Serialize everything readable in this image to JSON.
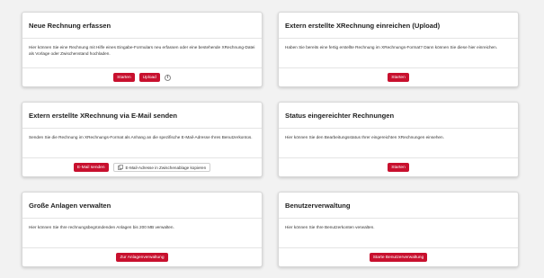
{
  "cards": [
    {
      "title": "Neue Rechnung erfassen",
      "description": "Hier können Sie eine Rechnung mit Hilfe eines Eingabe-Formulars neu erfassen oder eine bestehende XRechnung-Datei als Vorlage oder Zwischenstand hochladen.",
      "buttons": [
        "Starten",
        "Upload"
      ],
      "info_icon": "info-icon"
    },
    {
      "title": "Extern erstellte XRechnung einreichen (Upload)",
      "description": "Haben Sie bereits eine fertig erstellte Rechnung im XRechnungs-Format? Dann können Sie diese hier einreichen.",
      "buttons": [
        "Starten"
      ]
    },
    {
      "title": "Extern erstellte XRechnung via E-Mail senden",
      "description": "Senden Sie die Rechnung im XRechnungs-Format als Anhang an die spezifische E-Mail-Adresse Ihres Benutzerkontos.",
      "buttons": [
        "E-Mail senden"
      ],
      "copy_button": "E-Mail-Adresse in Zwischenablage kopieren",
      "copy_icon": "copy-icon"
    },
    {
      "title": "Status eingereichter Rechnungen",
      "description": "Hier können Sie den Bearbeitungsstatus Ihrer eingereichten XRechnungen einsehen.",
      "buttons": [
        "Starten"
      ]
    },
    {
      "title": "Große Anlagen verwalten",
      "description": "Hier können Sie Ihre rechnungsbegründenden Anlagen bis 200 MB verwalten.",
      "buttons": [
        "Zur Anlagenverwaltung"
      ]
    },
    {
      "title": "Benutzerverwaltung",
      "description": "Hier können Sie Ihre Benutzerkonten verwalten.",
      "buttons": [
        "Starte Benutzerverwaltung"
      ]
    }
  ],
  "colors": {
    "accent": "#c8102e",
    "background": "#f2f2f2",
    "card": "#ffffff"
  }
}
